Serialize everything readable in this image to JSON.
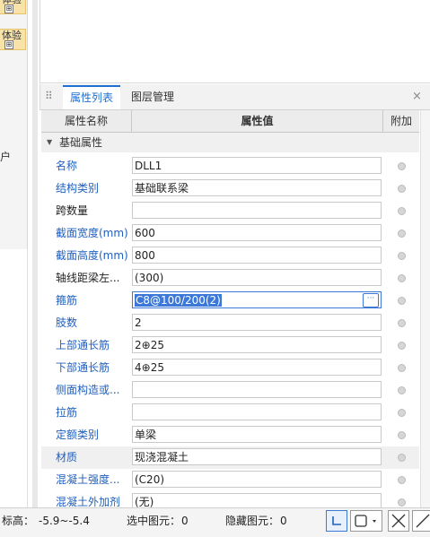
{
  "left_panel": {
    "tags": [
      {
        "label": "体验",
        "sub": "⊞"
      },
      {
        "label": "体验",
        "sub": "⊞"
      }
    ],
    "side_char": "户"
  },
  "tabs": {
    "items": [
      "属性列表",
      "图层管理"
    ],
    "active": "属性列表",
    "close_glyph": "×",
    "grip_glyph": "⠿"
  },
  "table": {
    "headers": {
      "name": "属性名称",
      "value": "属性值",
      "add": "附加"
    },
    "group": {
      "label": "基础属性",
      "collapse_glyph": "▼"
    },
    "rows": [
      {
        "name": "名称",
        "value": "DLL1",
        "name_color": "blue"
      },
      {
        "name": "结构类别",
        "value": "基础联系梁",
        "name_color": "blue"
      },
      {
        "name": "跨数量",
        "value": "",
        "name_color": "black"
      },
      {
        "name": "截面宽度(mm)",
        "value": "600",
        "name_color": "blue"
      },
      {
        "name": "截面高度(mm)",
        "value": "800",
        "name_color": "blue"
      },
      {
        "name": "轴线距梁左...",
        "value": "(300)",
        "name_color": "black"
      },
      {
        "name": "箍筋",
        "value": "C8@100/200(2)",
        "name_color": "blue",
        "editing": true,
        "button": "···"
      },
      {
        "name": "肢数",
        "value": "2",
        "name_color": "blue"
      },
      {
        "name": "上部通长筋",
        "value": "2⊕25",
        "name_color": "blue"
      },
      {
        "name": "下部通长筋",
        "value": "4⊕25",
        "name_color": "blue"
      },
      {
        "name": "侧面构造或...",
        "value": "",
        "name_color": "blue"
      },
      {
        "name": "拉筋",
        "value": "",
        "name_color": "blue"
      },
      {
        "name": "定额类别",
        "value": "单梁",
        "name_color": "blue"
      },
      {
        "name": "材质",
        "value": "现浇混凝土",
        "name_color": "blue",
        "highlight": true
      },
      {
        "name": "混凝土强度...",
        "value": "(C20)",
        "name_color": "blue"
      },
      {
        "name": "混凝土外加剂",
        "value": "(无)",
        "name_color": "blue"
      }
    ]
  },
  "status_bar": {
    "elevation_label": "标高：",
    "elevation_value": "-5.9~-5.4",
    "selected_label": "选中图元：",
    "selected_value": "0",
    "hidden_label": "隐藏图元：",
    "hidden_value": "0",
    "accent_color": "#3b78d8"
  }
}
